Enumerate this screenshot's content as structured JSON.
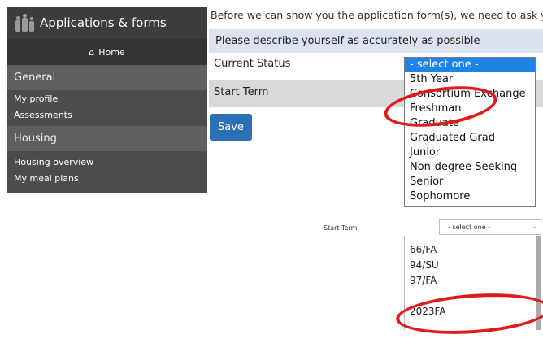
{
  "sidebar": {
    "title": "Applications & forms",
    "home_label": "Home",
    "sections": [
      {
        "title": "General",
        "links": [
          "My profile",
          "Assessments"
        ]
      },
      {
        "title": "Housing",
        "links": [
          "Housing overview",
          "My meal plans"
        ]
      }
    ]
  },
  "main": {
    "intro_text": "Before we can show you the application form(s), we need to ask you a",
    "describe_header": "Please describe yourself as accurately as possible",
    "fields": [
      {
        "label": "Current Status"
      },
      {
        "label": "Start Term"
      }
    ],
    "save_label": "Save"
  },
  "status_dropdown": {
    "options": [
      "- select one -",
      "5th Year",
      "Consortium Exchange",
      "Freshman",
      "Graduate",
      "Graduated Grad",
      "Junior",
      "Non-degree Seeking",
      "Senior",
      "Sophomore"
    ],
    "selected": "- select one -"
  },
  "term_zoom": {
    "label": "Start Term",
    "select_value": "- select one -",
    "options": [
      "66/FA",
      "94/SU",
      "97/FA",
      "2023FA"
    ]
  },
  "colors": {
    "accent_blue": "#2c6fb5",
    "highlight_blue": "#1f83e6",
    "annotation_red": "#e01b1b"
  }
}
